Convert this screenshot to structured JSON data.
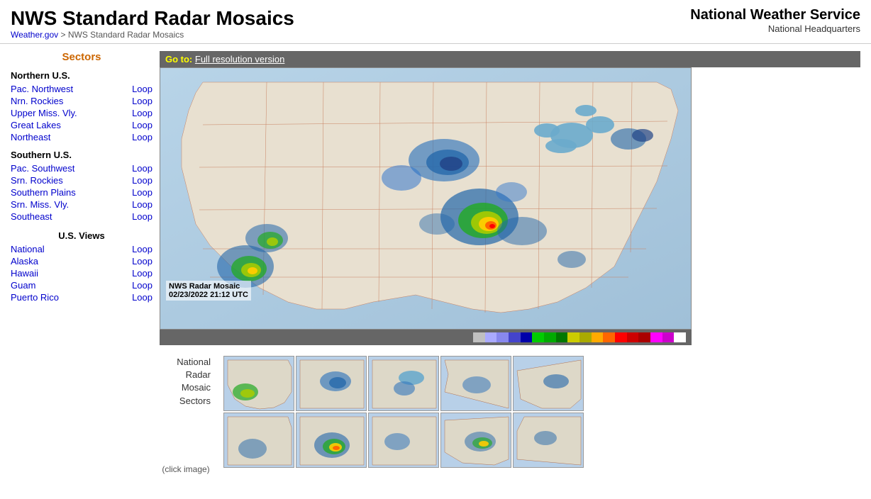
{
  "header": {
    "title": "NWS Standard Radar Mosaics",
    "breadcrumb_home": "Weather.gov",
    "breadcrumb_current": "NWS Standard Radar Mosaics",
    "nws_title": "National Weather Service",
    "nws_sub": "National Headquarters"
  },
  "goto_bar": {
    "prefix": "Go to:",
    "link_text": "Full resolution version"
  },
  "radar_label_line1": "NWS Radar Mosaic",
  "radar_label_line2": "02/23/2022 21:12 UTC",
  "sidebar": {
    "sections_title": "Sectors",
    "northern_title": "Northern U.S.",
    "southern_title": "Southern U.S.",
    "us_views_title": "U.S. Views",
    "northern_items": [
      {
        "label": "Pac. Northwest",
        "loop_label": "Loop"
      },
      {
        "label": "Nrn. Rockies",
        "loop_label": "Loop"
      },
      {
        "label": "Upper Miss. Vly.",
        "loop_label": "Loop"
      },
      {
        "label": "Great Lakes",
        "loop_label": "Loop"
      },
      {
        "label": "Northeast",
        "loop_label": "Loop"
      }
    ],
    "southern_items": [
      {
        "label": "Pac. Southwest",
        "loop_label": "Loop"
      },
      {
        "label": "Srn. Rockies",
        "loop_label": "Loop"
      },
      {
        "label": "Southern Plains",
        "loop_label": "Loop"
      },
      {
        "label": "Srn. Miss. Vly.",
        "loop_label": "Loop"
      },
      {
        "label": "Southeast",
        "loop_label": "Loop"
      }
    ],
    "us_items": [
      {
        "label": "National",
        "loop_label": "Loop"
      },
      {
        "label": "Alaska",
        "loop_label": "Loop"
      },
      {
        "label": "Hawaii",
        "loop_label": "Loop"
      },
      {
        "label": "Guam",
        "loop_label": "Loop"
      },
      {
        "label": "Puerto Rico",
        "loop_label": "Loop"
      }
    ]
  },
  "mosaic": {
    "label_line1": "National",
    "label_line2": "Radar",
    "label_line3": "Mosaic",
    "label_line4": "Sectors",
    "click_label": "(click image)"
  },
  "colors": {
    "accent_orange": "#cc6600",
    "link_blue": "#0000cc",
    "goto_bg": "#666666",
    "colorbar_bg": "#666666"
  }
}
